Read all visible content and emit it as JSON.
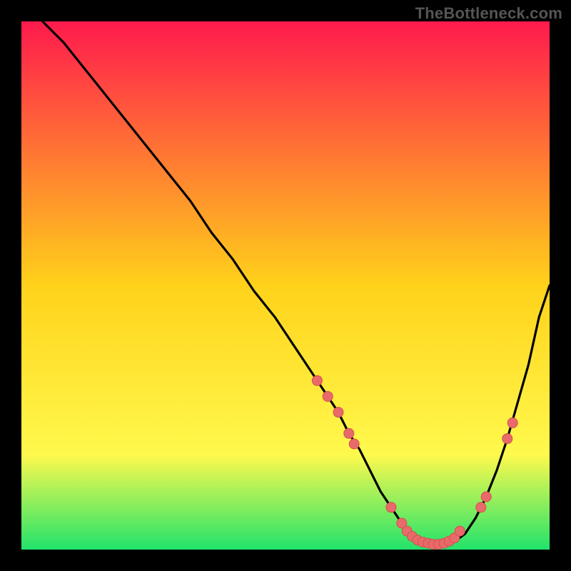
{
  "watermark": "TheBottleneck.com",
  "colors": {
    "background": "#000000",
    "gradient_top": "#ff1a4d",
    "gradient_mid": "#ffd21a",
    "gradient_low": "#fff94d",
    "gradient_bottom": "#21e36b",
    "curve": "#000000",
    "marker_fill": "#e96a6a",
    "marker_stroke": "#d44f4f",
    "frame": "#000000"
  },
  "chart_data": {
    "type": "line",
    "title": "",
    "xlabel": "",
    "ylabel": "",
    "xlim": [
      0,
      100
    ],
    "ylim": [
      0,
      100
    ],
    "grid": false,
    "legend": false,
    "series": [
      {
        "name": "bottleneck-curve",
        "x": [
          4,
          8,
          12,
          16,
          20,
          24,
          28,
          32,
          36,
          40,
          44,
          48,
          52,
          54,
          56,
          58,
          60,
          62,
          64,
          66,
          68,
          70,
          72,
          74,
          76,
          78,
          80,
          82,
          84,
          86,
          88,
          90,
          92,
          94,
          96,
          98,
          100
        ],
        "y": [
          100,
          96,
          91,
          86,
          81,
          76,
          71,
          66,
          60,
          55,
          49,
          44,
          38,
          35,
          32,
          29,
          26,
          22,
          19,
          15,
          11,
          8,
          5,
          3,
          1.5,
          1,
          1,
          1.5,
          3,
          6,
          10,
          15,
          21,
          28,
          35,
          44,
          50
        ]
      }
    ],
    "markers": [
      {
        "x": 56,
        "y": 32
      },
      {
        "x": 58,
        "y": 29
      },
      {
        "x": 60,
        "y": 26
      },
      {
        "x": 62,
        "y": 22
      },
      {
        "x": 63,
        "y": 20
      },
      {
        "x": 70,
        "y": 8
      },
      {
        "x": 72,
        "y": 5
      },
      {
        "x": 73,
        "y": 3.5
      },
      {
        "x": 74,
        "y": 2.5
      },
      {
        "x": 75,
        "y": 1.8
      },
      {
        "x": 76,
        "y": 1.4
      },
      {
        "x": 77,
        "y": 1.2
      },
      {
        "x": 78,
        "y": 1.0
      },
      {
        "x": 79,
        "y": 1.0
      },
      {
        "x": 80,
        "y": 1.2
      },
      {
        "x": 81,
        "y": 1.6
      },
      {
        "x": 82,
        "y": 2.2
      },
      {
        "x": 83,
        "y": 3.5
      },
      {
        "x": 87,
        "y": 8
      },
      {
        "x": 88,
        "y": 10
      },
      {
        "x": 92,
        "y": 21
      },
      {
        "x": 93,
        "y": 24
      }
    ]
  }
}
